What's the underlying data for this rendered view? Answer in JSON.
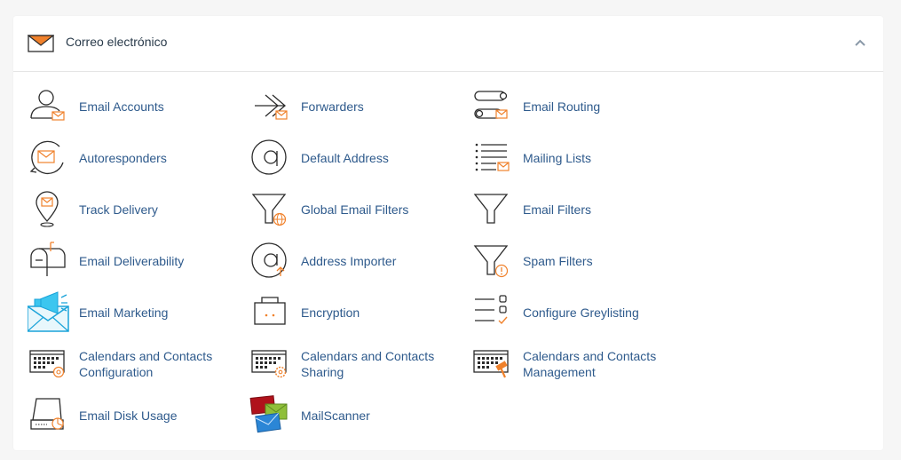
{
  "section": {
    "title": "Correo electrónico",
    "icon": "envelope-icon",
    "collapse_icon": "chevron-up-icon"
  },
  "colors": {
    "accent_orange": "#f0812b",
    "link_blue": "#2e5a8c",
    "icon_dark": "#2b2b2b"
  },
  "items": [
    {
      "label": "Email Accounts",
      "icon": "user-envelope-icon"
    },
    {
      "label": "Forwarders",
      "icon": "forward-arrow-icon"
    },
    {
      "label": "Email Routing",
      "icon": "routing-icon"
    },
    {
      "label": "Autoresponders",
      "icon": "autoresponder-icon"
    },
    {
      "label": "Default Address",
      "icon": "at-sign-icon"
    },
    {
      "label": "Mailing Lists",
      "icon": "list-envelope-icon"
    },
    {
      "label": "Track Delivery",
      "icon": "map-pin-icon"
    },
    {
      "label": "Global Email Filters",
      "icon": "funnel-globe-icon"
    },
    {
      "label": "Email Filters",
      "icon": "funnel-icon"
    },
    {
      "label": "Email Deliverability",
      "icon": "mailbox-icon"
    },
    {
      "label": "Address Importer",
      "icon": "at-import-icon"
    },
    {
      "label": "Spam Filters",
      "icon": "funnel-warning-icon"
    },
    {
      "label": "Email Marketing",
      "icon": "megaphone-envelope-icon"
    },
    {
      "label": "Encryption",
      "icon": "briefcase-lock-icon"
    },
    {
      "label": "Configure Greylisting",
      "icon": "checklist-icon"
    },
    {
      "label": "Calendars and Contacts\nConfiguration",
      "icon": "calendar-at-icon"
    },
    {
      "label": "Calendars and Contacts\nSharing",
      "icon": "calendar-gear-icon"
    },
    {
      "label": "Calendars and Contacts\nManagement",
      "icon": "calendar-hammer-icon"
    },
    {
      "label": "Email Disk Usage",
      "icon": "disk-usage-icon"
    },
    {
      "label": "MailScanner",
      "icon": "mailscanner-icon"
    }
  ]
}
